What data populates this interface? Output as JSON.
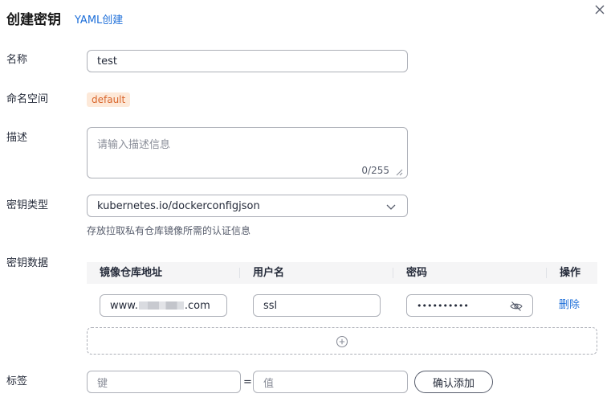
{
  "header": {
    "title": "创建密钥",
    "yaml_link": "YAML创建"
  },
  "form": {
    "name": {
      "label": "名称",
      "value": "test"
    },
    "namespace": {
      "label": "命名空间",
      "value": "default"
    },
    "description": {
      "label": "描述",
      "placeholder": "请输入描述信息",
      "counter": "0/255"
    },
    "secret_type": {
      "label": "密钥类型",
      "value": "kubernetes.io/dockerconfigjson",
      "hint": "存放拉取私有仓库镜像所需的认证信息"
    },
    "secret_data": {
      "label": "密钥数据",
      "columns": [
        "镜像仓库地址",
        "用户名",
        "密码",
        "操作"
      ],
      "rows": [
        {
          "registry_prefix": "www.",
          "registry_suffix": ".com",
          "username": "ssl",
          "password": "••••••••••",
          "action": "删除"
        }
      ]
    },
    "tags": {
      "label": "标签",
      "key_placeholder": "键",
      "equals": "=",
      "value_placeholder": "值",
      "confirm_button": "确认添加"
    }
  },
  "colors": {
    "accent": "#1e6fd9",
    "badge_bg": "#fde9d9",
    "badge_text": "#d9652b",
    "border": "#adb0b8"
  }
}
